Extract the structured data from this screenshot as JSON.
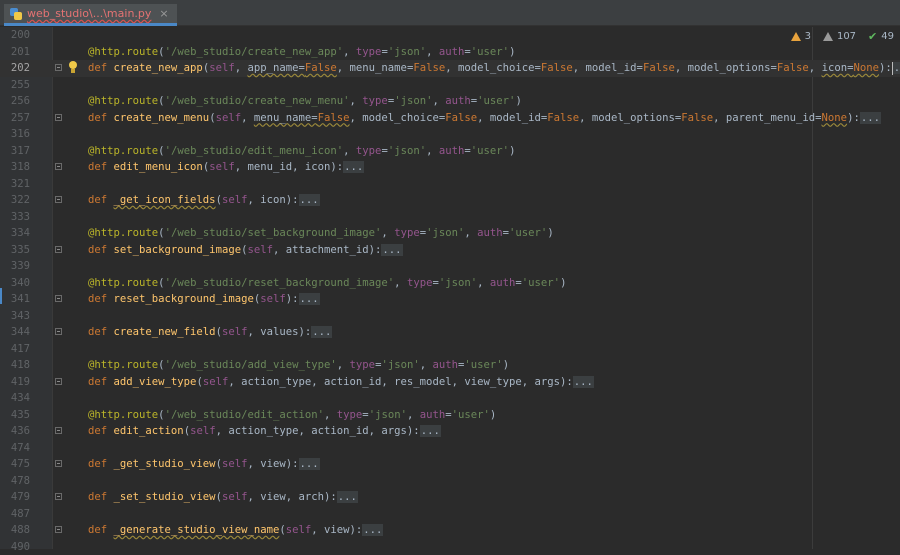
{
  "tab": {
    "title": "web_studio\\...\\main.py",
    "close": "×"
  },
  "inspections": {
    "warnings": "3",
    "weak_warnings": "107",
    "typos": "49"
  },
  "lines": [
    {
      "n": "200",
      "fold": false,
      "current": false,
      "bulb": false,
      "tokens": []
    },
    {
      "n": "201",
      "fold": false,
      "current": false,
      "bulb": false,
      "tokens": [
        {
          "c": "dec",
          "t": "@http.route"
        },
        {
          "c": "",
          "t": "("
        },
        {
          "c": "str",
          "t": "'/web_studio/create_new_app'"
        },
        {
          "c": "",
          "t": ", "
        },
        {
          "c": "par",
          "t": "type"
        },
        {
          "c": "",
          "t": "="
        },
        {
          "c": "str",
          "t": "'json'"
        },
        {
          "c": "",
          "t": ", "
        },
        {
          "c": "par",
          "t": "auth"
        },
        {
          "c": "",
          "t": "="
        },
        {
          "c": "str",
          "t": "'user'"
        },
        {
          "c": "",
          "t": ")"
        }
      ]
    },
    {
      "n": "202",
      "fold": true,
      "current": true,
      "bulb": true,
      "tokens": [
        {
          "c": "kw",
          "t": "def "
        },
        {
          "c": "fn",
          "t": "create_new_app"
        },
        {
          "c": "",
          "t": "("
        },
        {
          "c": "par",
          "t": "self"
        },
        {
          "c": "",
          "t": ", "
        },
        {
          "c": "wavy",
          "t": "app_name="
        },
        {
          "c": "kw wavy",
          "t": "False"
        },
        {
          "c": "",
          "t": ", menu_name="
        },
        {
          "c": "kw",
          "t": "False"
        },
        {
          "c": "",
          "t": ", model_choice="
        },
        {
          "c": "kw",
          "t": "False"
        },
        {
          "c": "",
          "t": ", model_id="
        },
        {
          "c": "kw",
          "t": "False"
        },
        {
          "c": "",
          "t": ", model_options="
        },
        {
          "c": "kw",
          "t": "False"
        },
        {
          "c": "",
          "t": ", "
        },
        {
          "c": "wavy",
          "t": "icon="
        },
        {
          "c": "kw wavy",
          "t": "None"
        },
        {
          "c": "",
          "t": "):"
        },
        {
          "c": "caret",
          "t": ""
        },
        {
          "c": "dots",
          "t": "..."
        }
      ]
    },
    {
      "n": "255",
      "fold": false,
      "current": false,
      "bulb": false,
      "tokens": []
    },
    {
      "n": "256",
      "fold": false,
      "current": false,
      "bulb": false,
      "tokens": [
        {
          "c": "dec",
          "t": "@http.route"
        },
        {
          "c": "",
          "t": "("
        },
        {
          "c": "str",
          "t": "'/web_studio/create_new_menu'"
        },
        {
          "c": "",
          "t": ", "
        },
        {
          "c": "par",
          "t": "type"
        },
        {
          "c": "",
          "t": "="
        },
        {
          "c": "str",
          "t": "'json'"
        },
        {
          "c": "",
          "t": ", "
        },
        {
          "c": "par",
          "t": "auth"
        },
        {
          "c": "",
          "t": "="
        },
        {
          "c": "str",
          "t": "'user'"
        },
        {
          "c": "",
          "t": ")"
        }
      ]
    },
    {
      "n": "257",
      "fold": true,
      "current": false,
      "bulb": false,
      "tokens": [
        {
          "c": "kw",
          "t": "def "
        },
        {
          "c": "fn",
          "t": "create_new_menu"
        },
        {
          "c": "",
          "t": "("
        },
        {
          "c": "par",
          "t": "self"
        },
        {
          "c": "",
          "t": ", "
        },
        {
          "c": "wavy",
          "t": "menu_name="
        },
        {
          "c": "kw wavy",
          "t": "False"
        },
        {
          "c": "",
          "t": ", model_choice="
        },
        {
          "c": "kw",
          "t": "False"
        },
        {
          "c": "",
          "t": ", model_id="
        },
        {
          "c": "kw",
          "t": "False"
        },
        {
          "c": "",
          "t": ", model_options="
        },
        {
          "c": "kw",
          "t": "False"
        },
        {
          "c": "",
          "t": ", parent_menu_id="
        },
        {
          "c": "kw wavy",
          "t": "None"
        },
        {
          "c": "",
          "t": "):"
        },
        {
          "c": "dots",
          "t": "..."
        }
      ]
    },
    {
      "n": "316",
      "fold": false,
      "current": false,
      "bulb": false,
      "tokens": []
    },
    {
      "n": "317",
      "fold": false,
      "current": false,
      "bulb": false,
      "tokens": [
        {
          "c": "dec",
          "t": "@http.route"
        },
        {
          "c": "",
          "t": "("
        },
        {
          "c": "str",
          "t": "'/web_studio/edit_menu_icon'"
        },
        {
          "c": "",
          "t": ", "
        },
        {
          "c": "par",
          "t": "type"
        },
        {
          "c": "",
          "t": "="
        },
        {
          "c": "str",
          "t": "'json'"
        },
        {
          "c": "",
          "t": ", "
        },
        {
          "c": "par",
          "t": "auth"
        },
        {
          "c": "",
          "t": "="
        },
        {
          "c": "str",
          "t": "'user'"
        },
        {
          "c": "",
          "t": ")"
        }
      ]
    },
    {
      "n": "318",
      "fold": true,
      "current": false,
      "bulb": false,
      "tokens": [
        {
          "c": "kw",
          "t": "def "
        },
        {
          "c": "fn",
          "t": "edit_menu_icon"
        },
        {
          "c": "",
          "t": "("
        },
        {
          "c": "par",
          "t": "self"
        },
        {
          "c": "",
          "t": ", menu_id, icon):"
        },
        {
          "c": "dots",
          "t": "..."
        }
      ]
    },
    {
      "n": "321",
      "fold": false,
      "current": false,
      "bulb": false,
      "tokens": []
    },
    {
      "n": "322",
      "fold": true,
      "current": false,
      "bulb": false,
      "tokens": [
        {
          "c": "kw",
          "t": "def "
        },
        {
          "c": "fn wavy",
          "t": "_get_icon_fields"
        },
        {
          "c": "",
          "t": "("
        },
        {
          "c": "par",
          "t": "self"
        },
        {
          "c": "",
          "t": ", icon):"
        },
        {
          "c": "dots",
          "t": "..."
        }
      ]
    },
    {
      "n": "333",
      "fold": false,
      "current": false,
      "bulb": false,
      "tokens": []
    },
    {
      "n": "334",
      "fold": false,
      "current": false,
      "bulb": false,
      "tokens": [
        {
          "c": "dec",
          "t": "@http.route"
        },
        {
          "c": "",
          "t": "("
        },
        {
          "c": "str",
          "t": "'/web_studio/set_background_image'"
        },
        {
          "c": "",
          "t": ", "
        },
        {
          "c": "par",
          "t": "type"
        },
        {
          "c": "",
          "t": "="
        },
        {
          "c": "str",
          "t": "'json'"
        },
        {
          "c": "",
          "t": ", "
        },
        {
          "c": "par",
          "t": "auth"
        },
        {
          "c": "",
          "t": "="
        },
        {
          "c": "str",
          "t": "'user'"
        },
        {
          "c": "",
          "t": ")"
        }
      ]
    },
    {
      "n": "335",
      "fold": true,
      "current": false,
      "bulb": false,
      "tokens": [
        {
          "c": "kw",
          "t": "def "
        },
        {
          "c": "fn",
          "t": "set_background_image"
        },
        {
          "c": "",
          "t": "("
        },
        {
          "c": "par",
          "t": "self"
        },
        {
          "c": "",
          "t": ", attachment_id):"
        },
        {
          "c": "dots",
          "t": "..."
        }
      ]
    },
    {
      "n": "339",
      "fold": false,
      "current": false,
      "bulb": false,
      "tokens": []
    },
    {
      "n": "340",
      "fold": false,
      "current": false,
      "bulb": false,
      "tokens": [
        {
          "c": "dec",
          "t": "@http.route"
        },
        {
          "c": "",
          "t": "("
        },
        {
          "c": "str",
          "t": "'/web_studio/reset_background_image'"
        },
        {
          "c": "",
          "t": ", "
        },
        {
          "c": "par",
          "t": "type"
        },
        {
          "c": "",
          "t": "="
        },
        {
          "c": "str",
          "t": "'json'"
        },
        {
          "c": "",
          "t": ", "
        },
        {
          "c": "par",
          "t": "auth"
        },
        {
          "c": "",
          "t": "="
        },
        {
          "c": "str",
          "t": "'user'"
        },
        {
          "c": "",
          "t": ")"
        }
      ]
    },
    {
      "n": "341",
      "fold": true,
      "current": false,
      "bulb": false,
      "tokens": [
        {
          "c": "kw",
          "t": "def "
        },
        {
          "c": "fn",
          "t": "reset_background_image"
        },
        {
          "c": "",
          "t": "("
        },
        {
          "c": "par",
          "t": "self"
        },
        {
          "c": "",
          "t": "):"
        },
        {
          "c": "dots",
          "t": "..."
        }
      ]
    },
    {
      "n": "343",
      "fold": false,
      "current": false,
      "bulb": false,
      "tokens": []
    },
    {
      "n": "344",
      "fold": true,
      "current": false,
      "bulb": false,
      "tokens": [
        {
          "c": "kw",
          "t": "def "
        },
        {
          "c": "fn",
          "t": "create_new_field"
        },
        {
          "c": "",
          "t": "("
        },
        {
          "c": "par",
          "t": "self"
        },
        {
          "c": "",
          "t": ", values):"
        },
        {
          "c": "dots",
          "t": "..."
        }
      ]
    },
    {
      "n": "417",
      "fold": false,
      "current": false,
      "bulb": false,
      "tokens": []
    },
    {
      "n": "418",
      "fold": false,
      "current": false,
      "bulb": false,
      "tokens": [
        {
          "c": "dec",
          "t": "@http.route"
        },
        {
          "c": "",
          "t": "("
        },
        {
          "c": "str",
          "t": "'/web_studio/add_view_type'"
        },
        {
          "c": "",
          "t": ", "
        },
        {
          "c": "par",
          "t": "type"
        },
        {
          "c": "",
          "t": "="
        },
        {
          "c": "str",
          "t": "'json'"
        },
        {
          "c": "",
          "t": ", "
        },
        {
          "c": "par",
          "t": "auth"
        },
        {
          "c": "",
          "t": "="
        },
        {
          "c": "str",
          "t": "'user'"
        },
        {
          "c": "",
          "t": ")"
        }
      ]
    },
    {
      "n": "419",
      "fold": true,
      "current": false,
      "bulb": false,
      "tokens": [
        {
          "c": "kw",
          "t": "def "
        },
        {
          "c": "fn",
          "t": "add_view_type"
        },
        {
          "c": "",
          "t": "("
        },
        {
          "c": "par",
          "t": "self"
        },
        {
          "c": "",
          "t": ", action_type, action_id, res_model, view_type, args):"
        },
        {
          "c": "dots",
          "t": "..."
        }
      ]
    },
    {
      "n": "434",
      "fold": false,
      "current": false,
      "bulb": false,
      "tokens": []
    },
    {
      "n": "435",
      "fold": false,
      "current": false,
      "bulb": false,
      "tokens": [
        {
          "c": "dec",
          "t": "@http.route"
        },
        {
          "c": "",
          "t": "("
        },
        {
          "c": "str",
          "t": "'/web_studio/edit_action'"
        },
        {
          "c": "",
          "t": ", "
        },
        {
          "c": "par",
          "t": "type"
        },
        {
          "c": "",
          "t": "="
        },
        {
          "c": "str",
          "t": "'json'"
        },
        {
          "c": "",
          "t": ", "
        },
        {
          "c": "par",
          "t": "auth"
        },
        {
          "c": "",
          "t": "="
        },
        {
          "c": "str",
          "t": "'user'"
        },
        {
          "c": "",
          "t": ")"
        }
      ]
    },
    {
      "n": "436",
      "fold": true,
      "current": false,
      "bulb": false,
      "tokens": [
        {
          "c": "kw",
          "t": "def "
        },
        {
          "c": "fn",
          "t": "edit_action"
        },
        {
          "c": "",
          "t": "("
        },
        {
          "c": "par",
          "t": "self"
        },
        {
          "c": "",
          "t": ", action_type, action_id, args):"
        },
        {
          "c": "dots",
          "t": "..."
        }
      ]
    },
    {
      "n": "474",
      "fold": false,
      "current": false,
      "bulb": false,
      "tokens": []
    },
    {
      "n": "475",
      "fold": true,
      "current": false,
      "bulb": false,
      "tokens": [
        {
          "c": "kw",
          "t": "def "
        },
        {
          "c": "fn",
          "t": "_get_studio_view"
        },
        {
          "c": "",
          "t": "("
        },
        {
          "c": "par",
          "t": "self"
        },
        {
          "c": "",
          "t": ", view):"
        },
        {
          "c": "dots",
          "t": "..."
        }
      ]
    },
    {
      "n": "478",
      "fold": false,
      "current": false,
      "bulb": false,
      "tokens": []
    },
    {
      "n": "479",
      "fold": true,
      "current": false,
      "bulb": false,
      "tokens": [
        {
          "c": "kw",
          "t": "def "
        },
        {
          "c": "fn",
          "t": "_set_studio_view"
        },
        {
          "c": "",
          "t": "("
        },
        {
          "c": "par",
          "t": "self"
        },
        {
          "c": "",
          "t": ", view, arch):"
        },
        {
          "c": "dots",
          "t": "..."
        }
      ]
    },
    {
      "n": "487",
      "fold": false,
      "current": false,
      "bulb": false,
      "tokens": []
    },
    {
      "n": "488",
      "fold": true,
      "current": false,
      "bulb": false,
      "tokens": [
        {
          "c": "kw",
          "t": "def "
        },
        {
          "c": "fn wavy",
          "t": "_generate_studio_view_name"
        },
        {
          "c": "",
          "t": "("
        },
        {
          "c": "par",
          "t": "self"
        },
        {
          "c": "",
          "t": ", view):"
        },
        {
          "c": "dots",
          "t": "..."
        }
      ]
    },
    {
      "n": "490",
      "fold": false,
      "current": false,
      "bulb": false,
      "tokens": []
    }
  ]
}
